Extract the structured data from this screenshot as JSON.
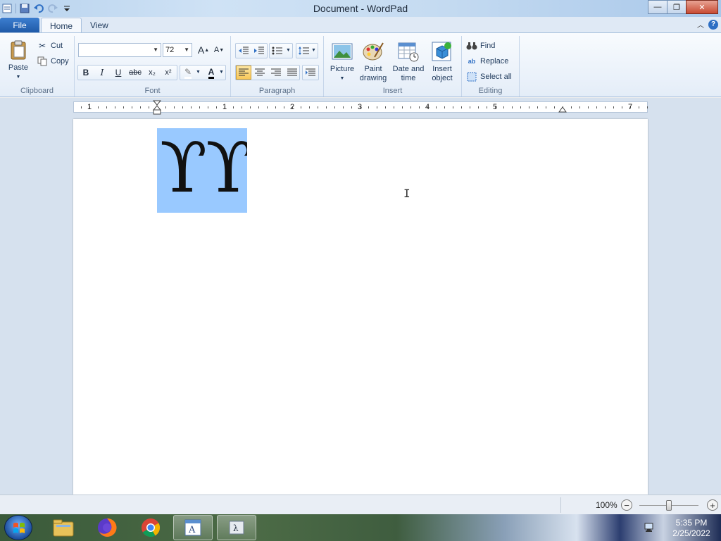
{
  "window": {
    "title": "Document - WordPad",
    "buttons": {
      "minimize": "—",
      "restore": "❐",
      "close": "✕"
    }
  },
  "tabs": {
    "file": "File",
    "home": "Home",
    "view": "View"
  },
  "clipboard": {
    "paste": "Paste",
    "cut": "Cut",
    "copy": "Copy",
    "label": "Clipboard"
  },
  "font": {
    "family": "",
    "size": "72",
    "label": "Font",
    "grow": "A",
    "shrink": "A",
    "bold": "B",
    "italic": "I",
    "underline": "U",
    "strike": "abc",
    "subscript": "x₂",
    "superscript": "x²",
    "highlight": "✎",
    "color": "A"
  },
  "paragraph": {
    "label": "Paragraph"
  },
  "insert": {
    "picture": "Picture",
    "paint1": "Paint",
    "paint2": "drawing",
    "date1": "Date and",
    "date2": "time",
    "obj1": "Insert",
    "obj2": "object",
    "label": "Insert"
  },
  "editing": {
    "find": "Find",
    "replace": "Replace",
    "select_all": "Select all",
    "label": "Editing"
  },
  "ruler": {
    "numbers": [
      "1",
      "1",
      "2",
      "3",
      "4",
      "5",
      "7"
    ]
  },
  "document": {
    "text": "ϒϒ",
    "cursor": "I"
  },
  "status": {
    "zoom": "100%",
    "zoom_out": "−",
    "zoom_in": "+"
  },
  "taskbar": {
    "time": "5:35 PM",
    "date": "2/25/2022"
  },
  "colors": {
    "selection": "#99c9ff",
    "accent": "#1f5aa8"
  }
}
